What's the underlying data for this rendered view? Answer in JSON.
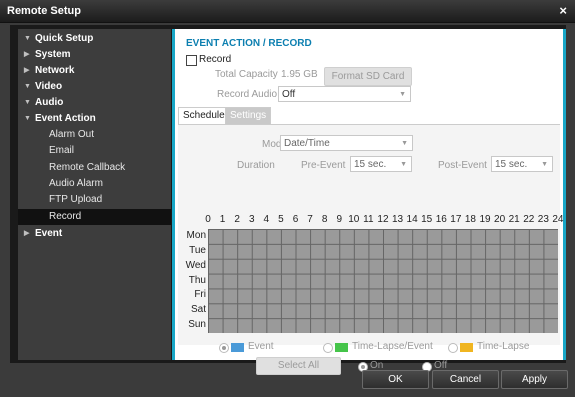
{
  "window": {
    "title": "Remote Setup",
    "close_label": "×"
  },
  "sidebar": {
    "items": [
      {
        "label": "Quick Setup",
        "arrow": "▼"
      },
      {
        "label": "System",
        "arrow": "▶"
      },
      {
        "label": "Network",
        "arrow": "▶"
      },
      {
        "label": "Video",
        "arrow": "▼"
      },
      {
        "label": "Audio",
        "arrow": "▼"
      },
      {
        "label": "Event Action",
        "arrow": "▼"
      },
      {
        "label": "Alarm Out"
      },
      {
        "label": "Email"
      },
      {
        "label": "Remote Callback"
      },
      {
        "label": "Audio Alarm"
      },
      {
        "label": "FTP Upload"
      },
      {
        "label": "Record"
      },
      {
        "label": "Event",
        "arrow": "▶"
      }
    ]
  },
  "main": {
    "heading": "EVENT ACTION / RECORD",
    "record_checkbox_label": "Record",
    "total_capacity_label": "Total Capacity",
    "total_capacity_value": "1.95 GB",
    "format_button": "Format SD Card",
    "record_audio_label": "Record Audio",
    "record_audio_value": "Off",
    "tabs": [
      {
        "label": "Schedule"
      },
      {
        "label": "Settings"
      }
    ],
    "mode_label": "Mode",
    "mode_value": "Date/Time",
    "duration_label": "Duration",
    "pre_event_label": "Pre-Event",
    "pre_event_value": "15 sec.",
    "post_event_label": "Post-Event",
    "post_event_value": "15 sec.",
    "hours": [
      "0",
      "1",
      "2",
      "3",
      "4",
      "5",
      "6",
      "7",
      "8",
      "9",
      "10",
      "11",
      "12",
      "13",
      "14",
      "15",
      "16",
      "17",
      "18",
      "19",
      "20",
      "21",
      "22",
      "23",
      "24"
    ],
    "days": [
      "Mon",
      "Tue",
      "Wed",
      "Thu",
      "Fri",
      "Sat",
      "Sun"
    ],
    "legend": [
      {
        "label": "Event",
        "color": "#4a9ad8"
      },
      {
        "label": "Time-Lapse/Event",
        "color": "#45c44a"
      },
      {
        "label": "Time-Lapse",
        "color": "#f0b520"
      }
    ],
    "select_all_button": "Select All",
    "on_label": "On",
    "off_label": "Off"
  },
  "footer": {
    "ok": "OK",
    "cancel": "Cancel",
    "apply": "Apply"
  }
}
